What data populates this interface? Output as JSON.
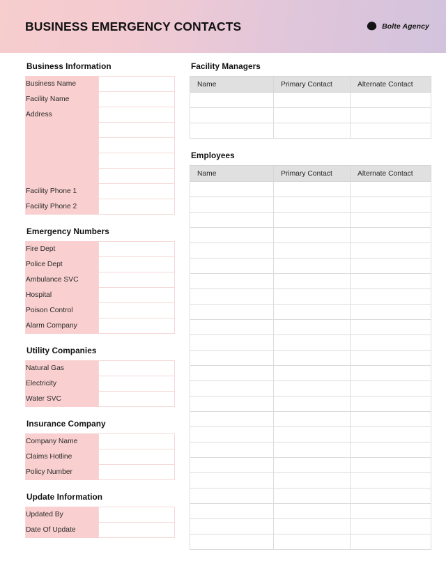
{
  "header": {
    "title": "BUSINESS EMERGENCY CONTACTS",
    "brand_name": "Bolte Agency",
    "brand_icon": "bowl-logo-icon",
    "gradient_from": "#f7cdcd",
    "gradient_to": "#d2c3dd"
  },
  "theme": {
    "label_fill": "#f9cfcf",
    "label_border": "#f6d5d5",
    "grid_header_fill": "#e0e0e0",
    "grid_border": "#dcdcdc",
    "text": "#1a1a1a"
  },
  "left_column": {
    "sections": [
      {
        "heading": "Business Information",
        "rows": [
          {
            "label": "Business Name",
            "value": ""
          },
          {
            "label": "Facility Name",
            "value": ""
          },
          {
            "label": "Address",
            "value": ""
          },
          {
            "label": "",
            "value": ""
          },
          {
            "label": "",
            "value": ""
          },
          {
            "label": "",
            "value": ""
          },
          {
            "label": "",
            "value": ""
          },
          {
            "label": "Facility Phone 1",
            "value": ""
          },
          {
            "label": "Facility Phone 2",
            "value": ""
          }
        ]
      },
      {
        "heading": "Emergency Numbers",
        "rows": [
          {
            "label": "Fire Dept",
            "value": ""
          },
          {
            "label": "Police Dept",
            "value": ""
          },
          {
            "label": "Ambulance SVC",
            "value": ""
          },
          {
            "label": "Hospital",
            "value": ""
          },
          {
            "label": "Poison Control",
            "value": ""
          },
          {
            "label": "Alarm Company",
            "value": ""
          }
        ]
      },
      {
        "heading": "Utility Companies",
        "rows": [
          {
            "label": "Natural Gas",
            "value": ""
          },
          {
            "label": "Electricity",
            "value": ""
          },
          {
            "label": "Water SVC",
            "value": ""
          }
        ]
      },
      {
        "heading": "Insurance Company",
        "rows": [
          {
            "label": "Company Name",
            "value": ""
          },
          {
            "label": "Claims Hotline",
            "value": ""
          },
          {
            "label": "Policy Number",
            "value": ""
          }
        ]
      },
      {
        "heading": "Update Information",
        "rows": [
          {
            "label": "Updated By",
            "value": ""
          },
          {
            "label": "Date Of Update",
            "value": ""
          }
        ]
      }
    ]
  },
  "right_column": {
    "sections": [
      {
        "heading": "Facility  Managers",
        "columns": [
          "Name",
          "Primary Contact",
          "Alternate Contact"
        ],
        "row_count": 3,
        "rows": [
          [
            "",
            "",
            ""
          ],
          [
            "",
            "",
            ""
          ],
          [
            "",
            "",
            ""
          ]
        ]
      },
      {
        "heading": "Employees",
        "columns": [
          "Name",
          "Primary Contact",
          "Alternate Contact"
        ],
        "row_count": 24,
        "rows": [
          [
            "",
            "",
            ""
          ],
          [
            "",
            "",
            ""
          ],
          [
            "",
            "",
            ""
          ],
          [
            "",
            "",
            ""
          ],
          [
            "",
            "",
            ""
          ],
          [
            "",
            "",
            ""
          ],
          [
            "",
            "",
            ""
          ],
          [
            "",
            "",
            ""
          ],
          [
            "",
            "",
            ""
          ],
          [
            "",
            "",
            ""
          ],
          [
            "",
            "",
            ""
          ],
          [
            "",
            "",
            ""
          ],
          [
            "",
            "",
            ""
          ],
          [
            "",
            "",
            ""
          ],
          [
            "",
            "",
            ""
          ],
          [
            "",
            "",
            ""
          ],
          [
            "",
            "",
            ""
          ],
          [
            "",
            "",
            ""
          ],
          [
            "",
            "",
            ""
          ],
          [
            "",
            "",
            ""
          ],
          [
            "",
            "",
            ""
          ],
          [
            "",
            "",
            ""
          ],
          [
            "",
            "",
            ""
          ],
          [
            "",
            "",
            ""
          ]
        ]
      }
    ]
  }
}
